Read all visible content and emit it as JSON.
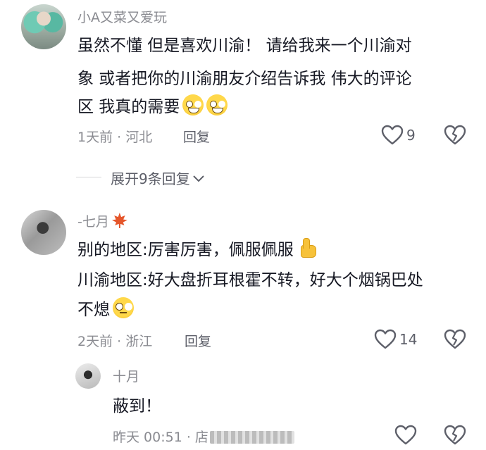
{
  "comments": [
    {
      "username": "小A又菜又爱玩",
      "lines": [
        "虽然不懂 但是喜欢川渝！ 请给我来一个川渝对",
        "象  或者把你的川渝朋友介绍告诉我 伟大的评论",
        "区 我真的需要"
      ],
      "time_location": "1天前 · 河北",
      "reply_label": "回复",
      "like_count": "9",
      "expand_label": "展开9条回复"
    },
    {
      "username": "-七月",
      "lines": [
        "别的地区:厉害厉害，佩服佩服",
        "川渝地区:好大盘折耳根霍不转，好大个烟锅巴处",
        "不熄"
      ],
      "time_location": "2天前 · 浙江",
      "reply_label": "回复",
      "like_count": "14"
    }
  ],
  "reply": {
    "username": "十月",
    "text": "蔽到！",
    "time_prefix": "昨天 00:51 · 店"
  },
  "colors": {
    "text": "#161823",
    "meta": "#8a8b91",
    "icon": "#5d5f69"
  },
  "icons": [
    "heart-outline-icon",
    "broken-heart-icon",
    "chevron-down-icon",
    "maple-leaf-icon",
    "grin-emoji-icon",
    "eye-roll-emoji-icon",
    "thumbs-up-emoji-icon"
  ]
}
